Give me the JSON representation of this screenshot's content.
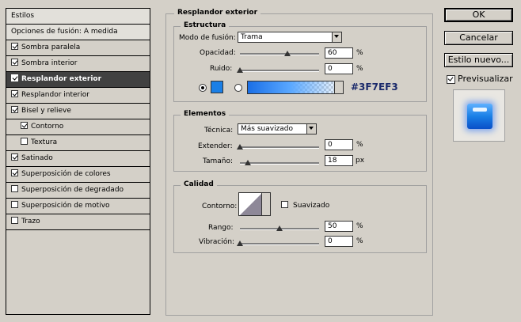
{
  "styles_panel": {
    "title": "Estilos",
    "header_item": "Opciones de fusión: A medida",
    "items": [
      {
        "label": "Sombra paralela",
        "checked": true
      },
      {
        "label": "Sombra interior",
        "checked": true
      },
      {
        "label": "Resplandor exterior",
        "checked": true,
        "selected": true
      },
      {
        "label": "Resplandor interior",
        "checked": true
      },
      {
        "label": "Bisel y relieve",
        "checked": true
      },
      {
        "label": "Contorno",
        "checked": true,
        "indent": true
      },
      {
        "label": "Textura",
        "checked": false,
        "indent": true
      },
      {
        "label": "Satinado",
        "checked": true
      },
      {
        "label": "Superposición de colores",
        "checked": true
      },
      {
        "label": "Superposición de degradado",
        "checked": false
      },
      {
        "label": "Superposición de motivo",
        "checked": false
      },
      {
        "label": "Trazo",
        "checked": false
      }
    ]
  },
  "outer_glow": {
    "title": "Resplandor exterior",
    "structure": {
      "title": "Estructura",
      "blend_mode_label": "Modo de fusión:",
      "blend_mode_value": "Trama",
      "opacity_label": "Opacidad:",
      "opacity_value": "60",
      "opacity_fraction": 0.6,
      "noise_label": "Ruido:",
      "noise_value": "0",
      "noise_fraction": 0.0,
      "percent": "%",
      "color_hex": "#3F7EF3",
      "swatch_color": "#1a7fe6"
    },
    "elements": {
      "title": "Elementos",
      "technique_label": "Técnica:",
      "technique_value": "Más suavizado",
      "spread_label": "Extender:",
      "spread_value": "0",
      "spread_fraction": 0.0,
      "size_label": "Tamaño:",
      "size_value": "18",
      "size_fraction": 0.1,
      "percent": "%",
      "px": "px"
    },
    "quality": {
      "title": "Calidad",
      "contour_label": "Contorno:",
      "antialias_label": "Suavizado",
      "antialias_checked": false,
      "range_label": "Rango:",
      "range_value": "50",
      "range_fraction": 0.5,
      "jitter_label": "Vibración:",
      "jitter_value": "0",
      "jitter_fraction": 0.0,
      "percent": "%"
    }
  },
  "buttons": {
    "ok": "OK",
    "cancel": "Cancelar",
    "new_style": "Estilo nuevo...",
    "preview_label": "Previsualizar",
    "preview_checked": true
  }
}
